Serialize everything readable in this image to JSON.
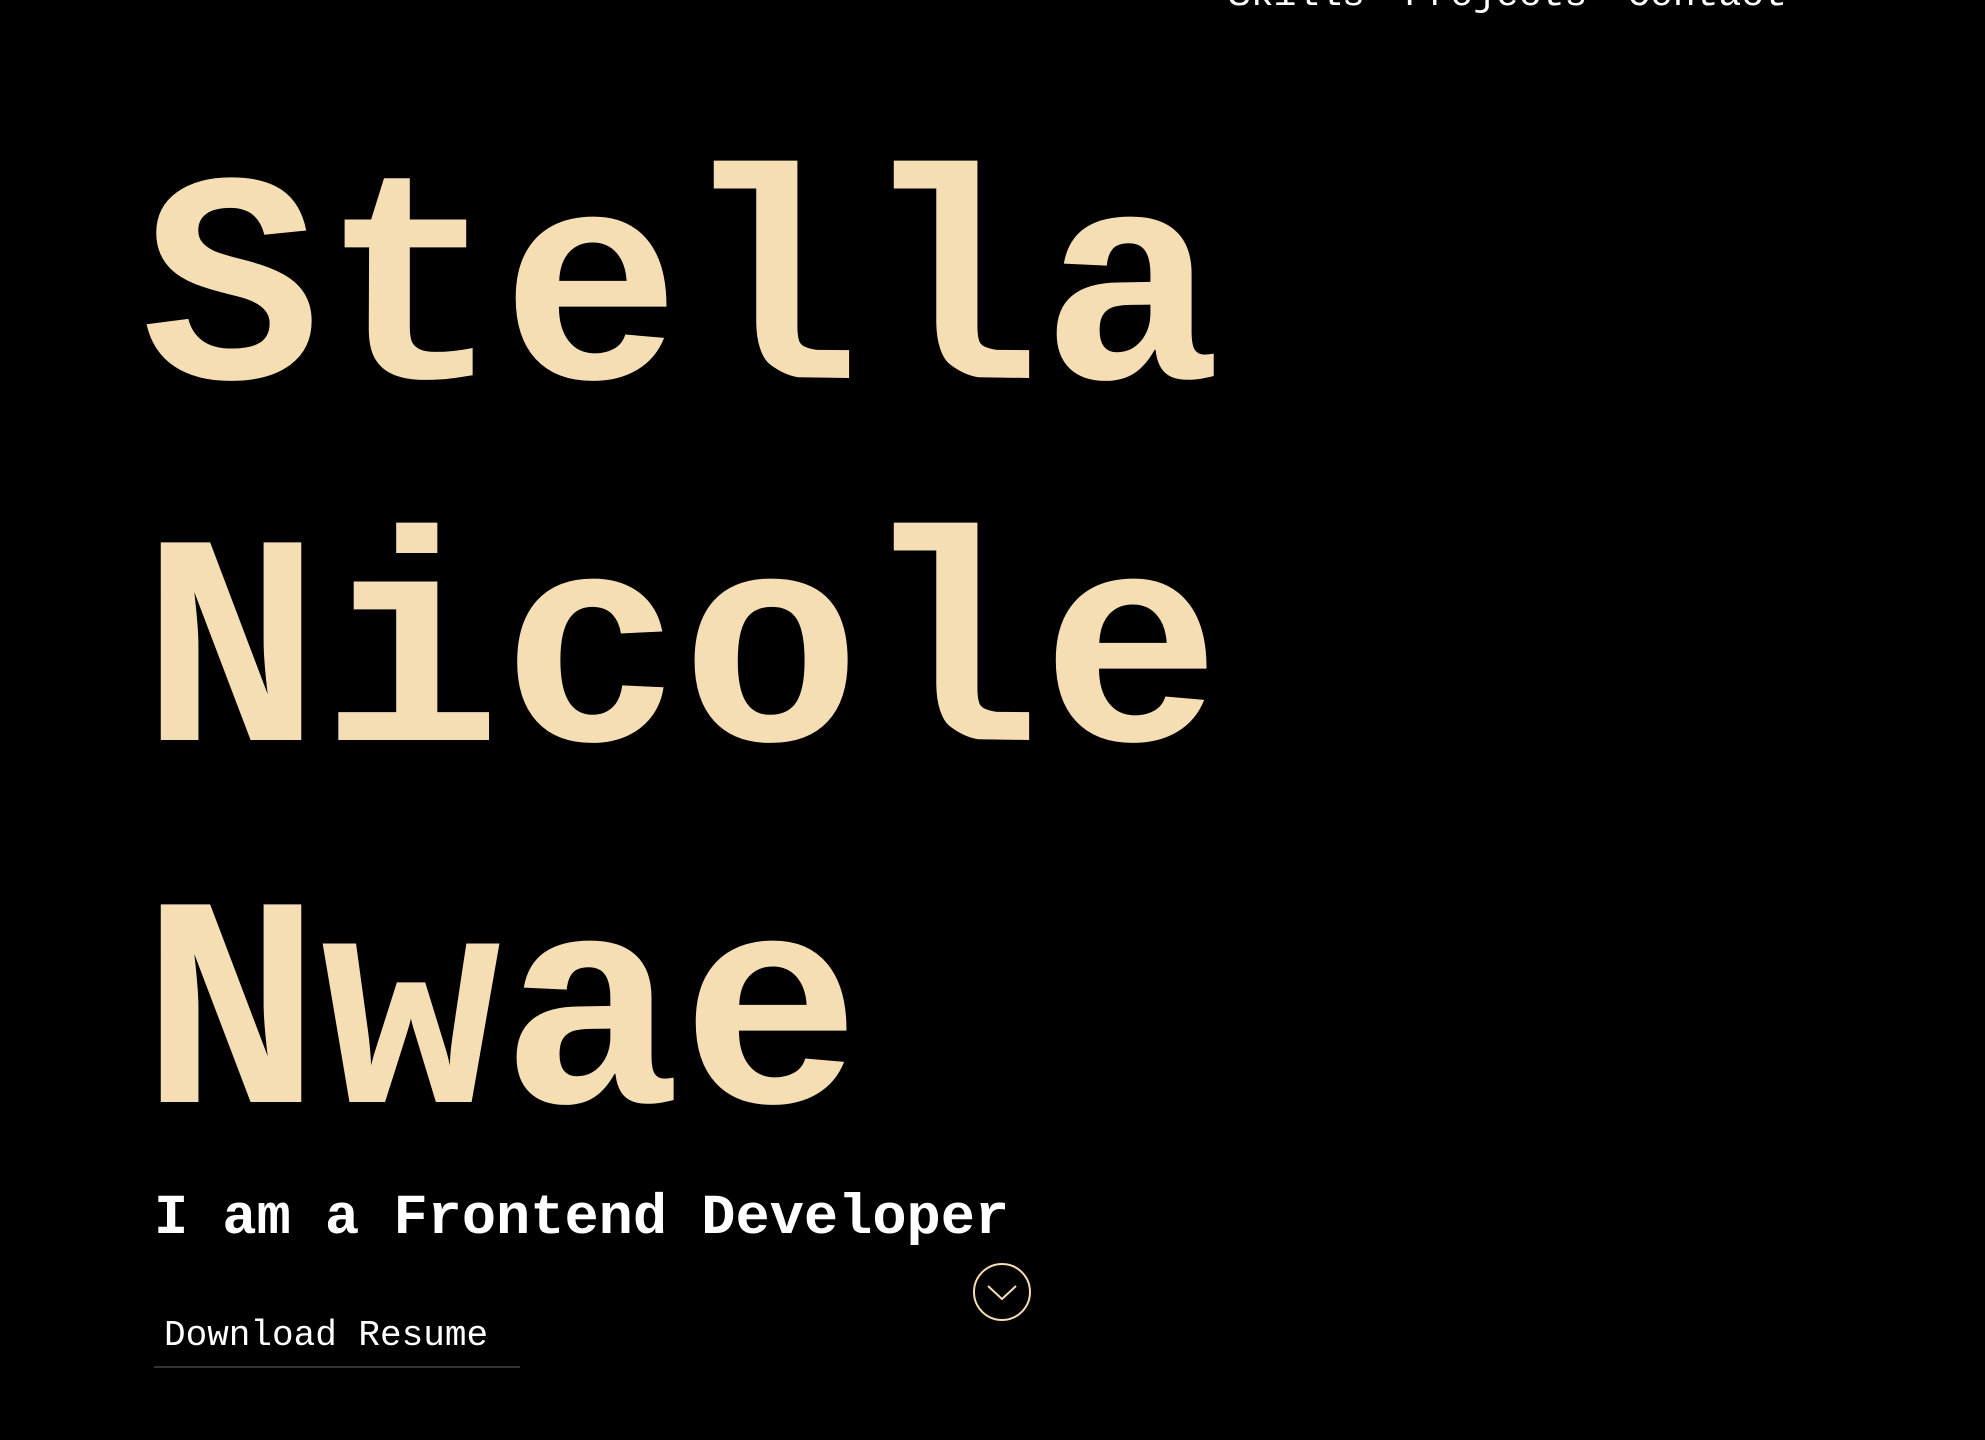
{
  "nav": {
    "items": [
      {
        "label": "Skills"
      },
      {
        "label": "Projects"
      },
      {
        "label": "Contact"
      }
    ]
  },
  "hero": {
    "name_lines": [
      "Stella",
      "Nicole",
      "Nwae"
    ],
    "tagline": "I am a Frontend Developer",
    "resume_label": "Download Resume",
    "scroll_icon": "chevron-down-icon"
  },
  "colors": {
    "background": "#000000",
    "accent": "#F5DEB3",
    "text": "#FFFFFF"
  }
}
